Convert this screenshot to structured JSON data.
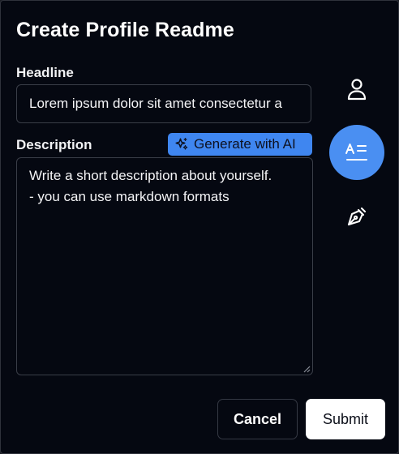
{
  "dialog": {
    "title": "Create Profile Readme"
  },
  "form": {
    "headline_label": "Headline",
    "headline_value": "Lorem ipsum dolor sit amet consectetur a",
    "description_label": "Description",
    "description_value": "Write a short description about yourself.\n- you can use markdown formats",
    "generate_label": "Generate with AI"
  },
  "side_nav": {
    "items": [
      {
        "icon": "user-icon",
        "active": false
      },
      {
        "icon": "readme-text-icon",
        "active": true
      },
      {
        "icon": "pen-nib-icon",
        "active": false
      }
    ]
  },
  "actions": {
    "cancel_label": "Cancel",
    "submit_label": "Submit"
  },
  "colors": {
    "background": "#050811",
    "accent": "#3f86f0",
    "active_circle": "#4a8ff2",
    "border": "#3a3e48"
  }
}
